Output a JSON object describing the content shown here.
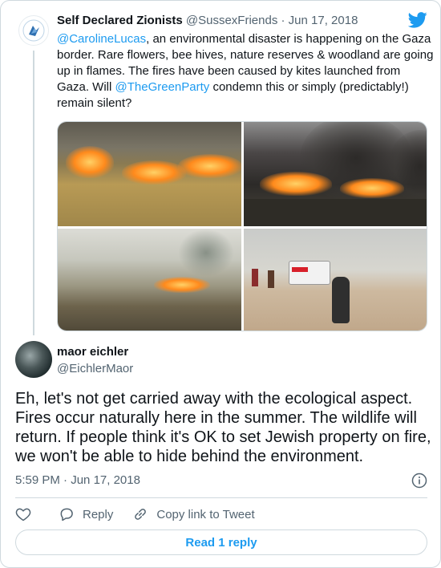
{
  "quoted_tweet": {
    "author_name": "Self Declared Zionists",
    "handle": "@SussexFriends",
    "separator": " · ",
    "date": "Jun 17, 2018",
    "text_parts": [
      {
        "type": "mention",
        "text": "@CarolineLucas"
      },
      {
        "type": "text",
        "text": ", an environmental disaster is happening on the Gaza border. Rare flowers, bee hives, nature reserves & woodland are going up in flames. The fires have been caused by kites launched from Gaza. Will "
      },
      {
        "type": "mention",
        "text": "@TheGreenParty"
      },
      {
        "type": "text",
        "text": " condemn this or simply (predictably!) remain silent?"
      }
    ],
    "media_count": 4
  },
  "reply_tweet": {
    "author_name": "maor eichler",
    "handle": "@EichlerMaor",
    "text": "Eh, let's not get carried away with the ecological aspect. Fires occur naturally here in the summer. The wildlife will return. If people think it's OK to set Jewish property on fire, we won't be able to hide behind the environment.",
    "time": "5:59 PM",
    "separator": " · ",
    "date": "Jun 17, 2018"
  },
  "actions": {
    "reply_label": "Reply",
    "copy_link_label": "Copy link to Tweet"
  },
  "read_replies_label": "Read 1 reply",
  "colors": {
    "accent": "#1d9bf0",
    "text_primary": "#0f1419",
    "text_secondary": "#536471",
    "border": "#cfd9de"
  },
  "icons": [
    "twitter-bird-icon",
    "info-icon",
    "heart-icon",
    "reply-icon",
    "link-icon"
  ]
}
